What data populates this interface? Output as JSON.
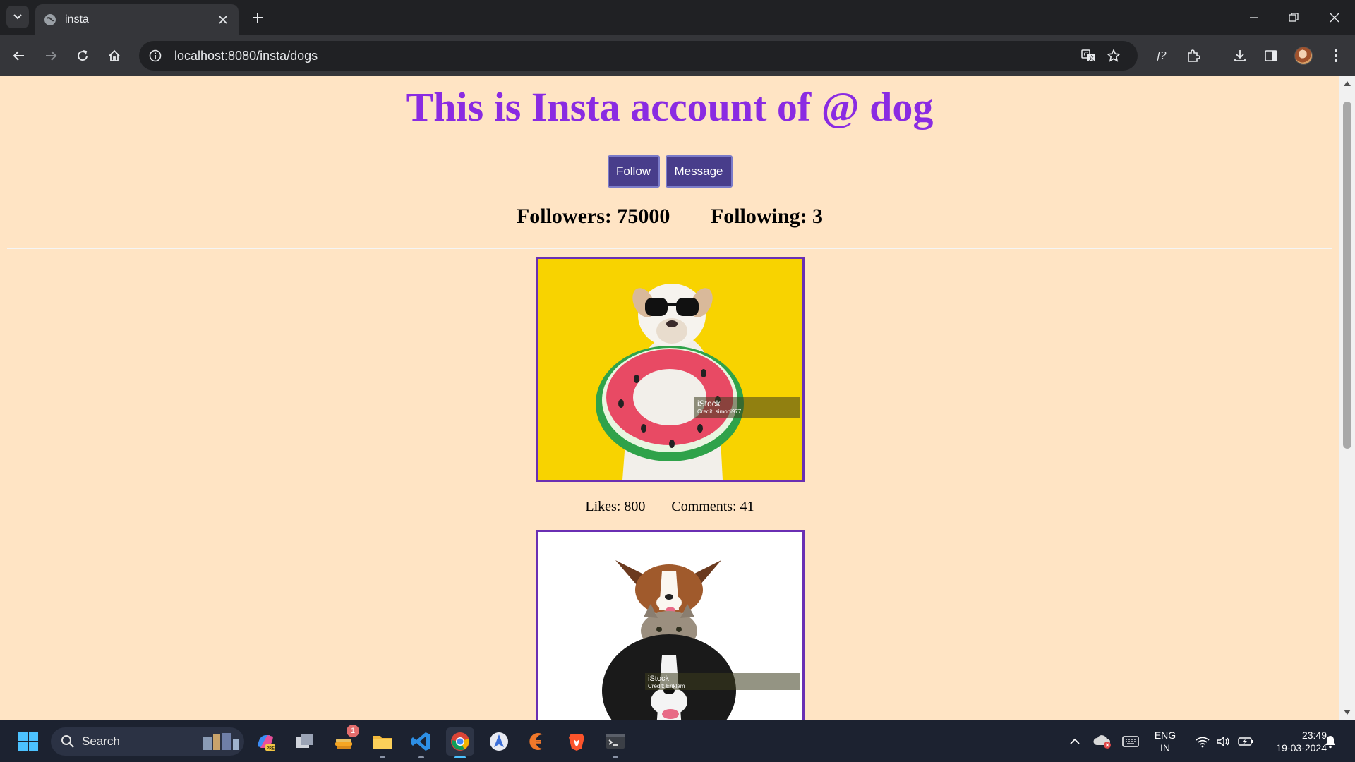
{
  "browser": {
    "tab_title": "insta",
    "url": "localhost:8080/insta/dogs"
  },
  "page": {
    "heading": "This is Insta account of @ dog",
    "buttons": {
      "follow": "Follow",
      "message": "Message"
    },
    "stats": {
      "followers": "Followers: 75000",
      "following": "Following: 3"
    },
    "posts": [
      {
        "likes": "Likes: 800",
        "comments": "Comments: 41",
        "watermark_brand": "iStock",
        "watermark_credit": "Credit: simoni977"
      },
      {
        "watermark_brand": "iStock",
        "watermark_credit": "Credit: Eriklam"
      }
    ]
  },
  "taskbar": {
    "search_placeholder": "Search",
    "notification_badge": "1",
    "language": "ENG",
    "region": "IN",
    "time": "23:49",
    "date": "19-03-2024"
  },
  "colors": {
    "page_background": "#ffe4c4",
    "heading_color": "#8a2be2",
    "button_color": "#483d8b",
    "image_border": "#6a2fb3"
  }
}
